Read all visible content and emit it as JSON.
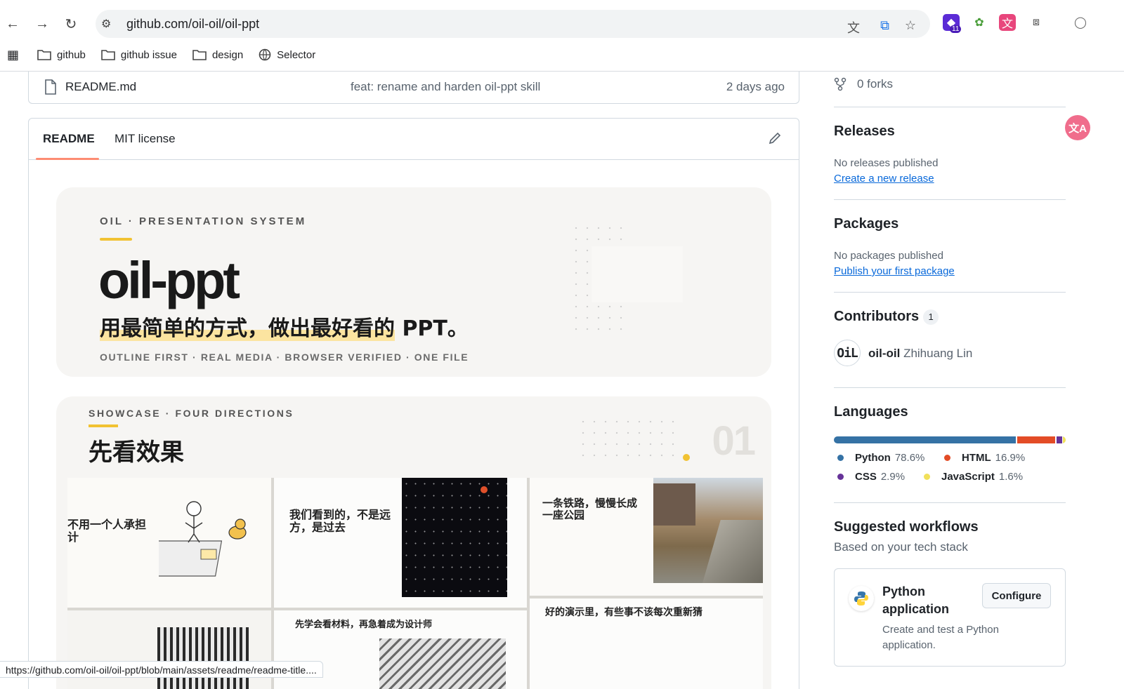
{
  "browser": {
    "url": "github.com/oil-oil/oil-ppt",
    "bookmarks": [
      "github",
      "github issue",
      "design",
      "Selector"
    ],
    "extension_badge": "11"
  },
  "file_row": {
    "name": "README.md",
    "commit": "feat: rename and harden oil-ppt skill",
    "date": "2 days ago"
  },
  "readme": {
    "tabs": [
      "README",
      "MIT license"
    ],
    "hero": {
      "eyebrow": "OIL · PRESENTATION SYSTEM",
      "title": "oil-ppt",
      "subtitle_highlight": "用最简单的方式，做出最好看的",
      "subtitle_rest": " PPT。",
      "tags": "OUTLINE FIRST · REAL MEDIA · BROWSER VERIFIED · ONE FILE"
    },
    "showcase": {
      "eyebrow": "SHOWCASE · FOUR DIRECTIONS",
      "title": "先看效果",
      "number": "01",
      "slides": {
        "s1": "不用一个人承担\n计",
        "s2": "我们看到的，不是远\n方，是过去",
        "s3": "一条铁路，慢慢长成\n一座公园",
        "s4": "先学会看材料，再急着成为设计师",
        "s5": "好的演示里，有些事不该每次重新猜"
      }
    }
  },
  "sidebar": {
    "forks": "0 forks",
    "releases": {
      "heading": "Releases",
      "none": "No releases published",
      "link": "Create a new release"
    },
    "packages": {
      "heading": "Packages",
      "none": "No packages published",
      "link": "Publish your first package"
    },
    "contributors": {
      "heading": "Contributors",
      "count": "1",
      "login": "oil-oil",
      "name": "Zhihuang Lin"
    },
    "languages": {
      "heading": "Languages",
      "items": [
        {
          "name": "Python",
          "percent": "78.6%",
          "color": "#3572A5"
        },
        {
          "name": "HTML",
          "percent": "16.9%",
          "color": "#e34c26"
        },
        {
          "name": "CSS",
          "percent": "2.9%",
          "color": "#663399"
        },
        {
          "name": "JavaScript",
          "percent": "1.6%",
          "color": "#f1e05a"
        }
      ]
    },
    "workflows": {
      "heading": "Suggested workflows",
      "sub": "Based on your tech stack",
      "card_title": "Python application",
      "card_desc": "Create and test a Python application.",
      "button": "Configure"
    }
  },
  "status_url": "https://github.com/oil-oil/oil-ppt/blob/main/assets/readme/readme-title...."
}
